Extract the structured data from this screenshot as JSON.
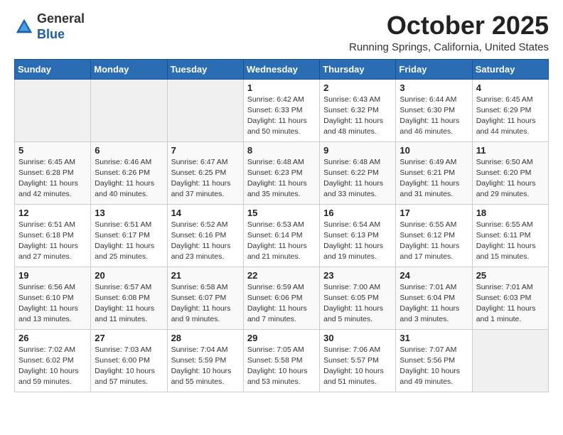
{
  "header": {
    "logo_general": "General",
    "logo_blue": "Blue",
    "month_title": "October 2025",
    "location": "Running Springs, California, United States"
  },
  "days_of_week": [
    "Sunday",
    "Monday",
    "Tuesday",
    "Wednesday",
    "Thursday",
    "Friday",
    "Saturday"
  ],
  "weeks": [
    [
      {
        "day": "",
        "info": ""
      },
      {
        "day": "",
        "info": ""
      },
      {
        "day": "",
        "info": ""
      },
      {
        "day": "1",
        "info": "Sunrise: 6:42 AM\nSunset: 6:33 PM\nDaylight: 11 hours\nand 50 minutes."
      },
      {
        "day": "2",
        "info": "Sunrise: 6:43 AM\nSunset: 6:32 PM\nDaylight: 11 hours\nand 48 minutes."
      },
      {
        "day": "3",
        "info": "Sunrise: 6:44 AM\nSunset: 6:30 PM\nDaylight: 11 hours\nand 46 minutes."
      },
      {
        "day": "4",
        "info": "Sunrise: 6:45 AM\nSunset: 6:29 PM\nDaylight: 11 hours\nand 44 minutes."
      }
    ],
    [
      {
        "day": "5",
        "info": "Sunrise: 6:45 AM\nSunset: 6:28 PM\nDaylight: 11 hours\nand 42 minutes."
      },
      {
        "day": "6",
        "info": "Sunrise: 6:46 AM\nSunset: 6:26 PM\nDaylight: 11 hours\nand 40 minutes."
      },
      {
        "day": "7",
        "info": "Sunrise: 6:47 AM\nSunset: 6:25 PM\nDaylight: 11 hours\nand 37 minutes."
      },
      {
        "day": "8",
        "info": "Sunrise: 6:48 AM\nSunset: 6:23 PM\nDaylight: 11 hours\nand 35 minutes."
      },
      {
        "day": "9",
        "info": "Sunrise: 6:48 AM\nSunset: 6:22 PM\nDaylight: 11 hours\nand 33 minutes."
      },
      {
        "day": "10",
        "info": "Sunrise: 6:49 AM\nSunset: 6:21 PM\nDaylight: 11 hours\nand 31 minutes."
      },
      {
        "day": "11",
        "info": "Sunrise: 6:50 AM\nSunset: 6:20 PM\nDaylight: 11 hours\nand 29 minutes."
      }
    ],
    [
      {
        "day": "12",
        "info": "Sunrise: 6:51 AM\nSunset: 6:18 PM\nDaylight: 11 hours\nand 27 minutes."
      },
      {
        "day": "13",
        "info": "Sunrise: 6:51 AM\nSunset: 6:17 PM\nDaylight: 11 hours\nand 25 minutes."
      },
      {
        "day": "14",
        "info": "Sunrise: 6:52 AM\nSunset: 6:16 PM\nDaylight: 11 hours\nand 23 minutes."
      },
      {
        "day": "15",
        "info": "Sunrise: 6:53 AM\nSunset: 6:14 PM\nDaylight: 11 hours\nand 21 minutes."
      },
      {
        "day": "16",
        "info": "Sunrise: 6:54 AM\nSunset: 6:13 PM\nDaylight: 11 hours\nand 19 minutes."
      },
      {
        "day": "17",
        "info": "Sunrise: 6:55 AM\nSunset: 6:12 PM\nDaylight: 11 hours\nand 17 minutes."
      },
      {
        "day": "18",
        "info": "Sunrise: 6:55 AM\nSunset: 6:11 PM\nDaylight: 11 hours\nand 15 minutes."
      }
    ],
    [
      {
        "day": "19",
        "info": "Sunrise: 6:56 AM\nSunset: 6:10 PM\nDaylight: 11 hours\nand 13 minutes."
      },
      {
        "day": "20",
        "info": "Sunrise: 6:57 AM\nSunset: 6:08 PM\nDaylight: 11 hours\nand 11 minutes."
      },
      {
        "day": "21",
        "info": "Sunrise: 6:58 AM\nSunset: 6:07 PM\nDaylight: 11 hours\nand 9 minutes."
      },
      {
        "day": "22",
        "info": "Sunrise: 6:59 AM\nSunset: 6:06 PM\nDaylight: 11 hours\nand 7 minutes."
      },
      {
        "day": "23",
        "info": "Sunrise: 7:00 AM\nSunset: 6:05 PM\nDaylight: 11 hours\nand 5 minutes."
      },
      {
        "day": "24",
        "info": "Sunrise: 7:01 AM\nSunset: 6:04 PM\nDaylight: 11 hours\nand 3 minutes."
      },
      {
        "day": "25",
        "info": "Sunrise: 7:01 AM\nSunset: 6:03 PM\nDaylight: 11 hours\nand 1 minute."
      }
    ],
    [
      {
        "day": "26",
        "info": "Sunrise: 7:02 AM\nSunset: 6:02 PM\nDaylight: 10 hours\nand 59 minutes."
      },
      {
        "day": "27",
        "info": "Sunrise: 7:03 AM\nSunset: 6:00 PM\nDaylight: 10 hours\nand 57 minutes."
      },
      {
        "day": "28",
        "info": "Sunrise: 7:04 AM\nSunset: 5:59 PM\nDaylight: 10 hours\nand 55 minutes."
      },
      {
        "day": "29",
        "info": "Sunrise: 7:05 AM\nSunset: 5:58 PM\nDaylight: 10 hours\nand 53 minutes."
      },
      {
        "day": "30",
        "info": "Sunrise: 7:06 AM\nSunset: 5:57 PM\nDaylight: 10 hours\nand 51 minutes."
      },
      {
        "day": "31",
        "info": "Sunrise: 7:07 AM\nSunset: 5:56 PM\nDaylight: 10 hours\nand 49 minutes."
      },
      {
        "day": "",
        "info": ""
      }
    ]
  ]
}
